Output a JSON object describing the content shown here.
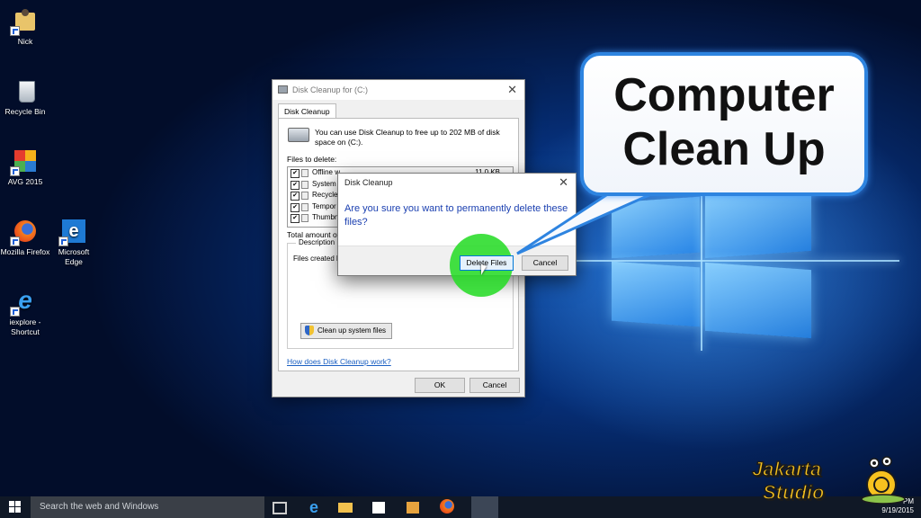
{
  "desktop": {
    "icons": [
      {
        "label": "Nick"
      },
      {
        "label": "Recycle Bin"
      },
      {
        "label": "AVG 2015"
      },
      {
        "label": "Mozilla Firefox"
      },
      {
        "label": "Microsoft Edge"
      },
      {
        "label": "iexplore - Shortcut"
      }
    ]
  },
  "disk_cleanup": {
    "title": "Disk Cleanup for  (C:)",
    "tab": "Disk Cleanup",
    "intro": "You can use Disk Cleanup to free up to 202 MB of disk space on  (C:).",
    "files_label": "Files to delete:",
    "files": [
      {
        "name": "Offline w",
        "size": "11.0 KB",
        "checked": "✔"
      },
      {
        "name": "System",
        "size": "",
        "checked": "✔"
      },
      {
        "name": "Recycle",
        "size": "",
        "checked": "✔"
      },
      {
        "name": "Tempor",
        "size": "",
        "checked": "✔"
      },
      {
        "name": "Thumbn",
        "size": "",
        "checked": "✔"
      }
    ],
    "total_label": "Total amount of",
    "description_legend": "Description",
    "description_text": "Files created b",
    "cleanup_system_button": "Clean up system files",
    "help_link": "How does Disk Cleanup work?",
    "ok_button": "OK",
    "cancel_button": "Cancel"
  },
  "confirm_dialog": {
    "title": "Disk Cleanup",
    "message": "Are you sure you want to permanently delete these files?",
    "delete_button": "Delete Files",
    "cancel_button": "Cancel"
  },
  "callout": {
    "line1": "Computer",
    "line2": "Clean Up"
  },
  "taskbar": {
    "search_placeholder": "Search the web and Windows",
    "time": "PM",
    "date": "9/19/2015"
  },
  "watermark": {
    "word1": "Jakarta",
    "word2": "Studio"
  },
  "colors": {
    "accent": "#2e84e0",
    "highlight": "#28dc28",
    "link": "#1a5fc2"
  }
}
